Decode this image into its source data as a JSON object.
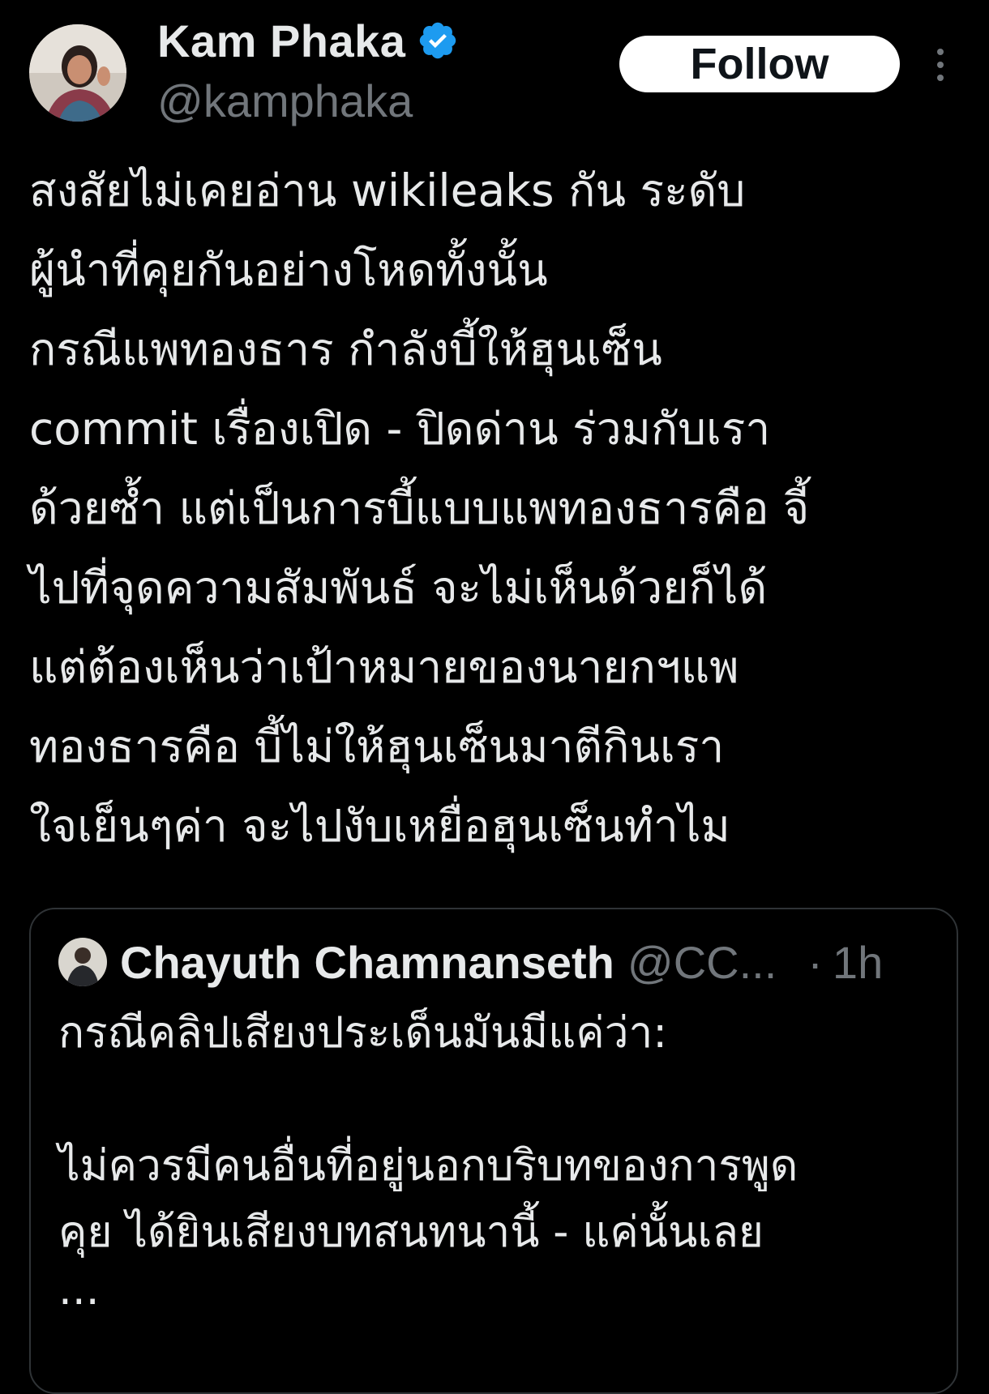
{
  "author": {
    "display_name": "Kam Phaka",
    "handle": "@kamphaka",
    "verified_icon": "verified-badge-icon",
    "avatar": "avatar-photo"
  },
  "actions": {
    "follow_label": "Follow",
    "more_icon": "more-vertical-icon"
  },
  "tweet": {
    "lines": [
      "สงสัยไม่เคยอ่าน wikileaks กัน ระดับ",
      "ผู้นำที่คุยกันอย่างโหดทั้งนั้น",
      "กรณีแพทองธาร กำลังบี้ให้ฮุนเซ็น",
      "commit เรื่องเปิด - ปิดด่าน ร่วมกับเรา",
      "ด้วยซ้ำ แต่เป็นการบี้แบบแพทองธารคือ จี้",
      "ไปที่จุดความสัมพันธ์ จะไม่เห็นด้วยก็ได้",
      "แต่ต้องเห็นว่าเป้าหมายของนายกฯแพ",
      "ทองธารคือ บี้ไม่ให้ฮุนเซ็นมาตีกินเรา",
      "ใจเย็นๆค่า จะไปงับเหยื่อฮุนเซ็นทำไม"
    ]
  },
  "quoted": {
    "display_name": "Chayuth Chamnanseth",
    "handle": "@CC...",
    "separator": "·",
    "time": "1h",
    "lines_before": [
      "กรณีคลิปเสียงประเด็นมันมีแค่ว่า:"
    ],
    "lines_after": [
      "ไม่ควรมีคนอื่นที่อยู่นอกบริบทของการพูด",
      "คุย ได้ยินเสียงบทสนทนานี้ - แค่นั้นเลย"
    ],
    "ellipsis": "..."
  },
  "colors": {
    "background": "#000000",
    "text_primary": "#e7e9ea",
    "text_secondary": "#71767b",
    "verified_blue": "#1d9bf0",
    "border": "#2f3336",
    "follow_bg": "#ffffff"
  }
}
